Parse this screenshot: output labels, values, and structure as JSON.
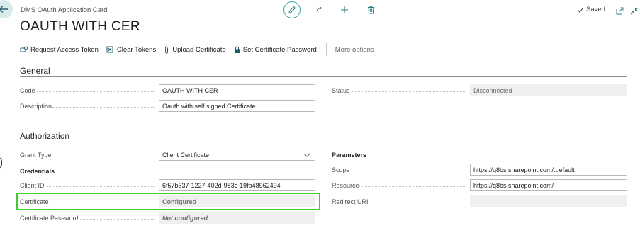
{
  "window": {
    "caption": "DMS OAuth Application Card",
    "title": "OAUTH WITH CER",
    "saved_label": "Saved"
  },
  "actions": {
    "request_access_token": "Request Access Token",
    "clear_tokens": "Clear Tokens",
    "upload_certificate": "Upload Certificate",
    "set_certificate_password": "Set Certificate Password",
    "more_options": "More options"
  },
  "general": {
    "heading": "General",
    "code_label": "Code",
    "code_value": "OAUTH WITH CER",
    "description_label": "Description",
    "description_value": "Oauth with self signed Certificate",
    "status_label": "Status",
    "status_value": "Disconnected"
  },
  "authorization": {
    "heading": "Authorization",
    "grant_type_label": "Grant Type",
    "grant_type_value": "Client Certificate",
    "credentials_label": "Credentials",
    "client_id_label": "Client ID",
    "client_id_value": "6f57b537-1227-402d-983c-19fb48962494",
    "certificate_label": "Certificate",
    "certificate_value": "Configured",
    "certificate_password_label": "Certificate Password",
    "certificate_password_value": "Not configured",
    "parameters_label": "Parameters",
    "scope_label": "Scope",
    "scope_value": "https://q8bs.sharepoint.com/.default",
    "resource_label": "Resource",
    "resource_value": "https://q8bs.sharepoint.com/",
    "redirect_uri_label": "Redirect URI",
    "redirect_uri_value": ""
  },
  "icons": {
    "back": "arrow-left-icon",
    "edit": "pencil-icon",
    "share": "share-icon",
    "new": "plus-icon",
    "delete": "trash-icon",
    "open_new": "open-in-new-window-icon",
    "collapse": "collapse-icon"
  },
  "colors": {
    "accent": "#3aa6a6",
    "highlight_box": "#3dcc2a",
    "configured": "#2a6d1a",
    "not_configured": "#a4262c"
  }
}
